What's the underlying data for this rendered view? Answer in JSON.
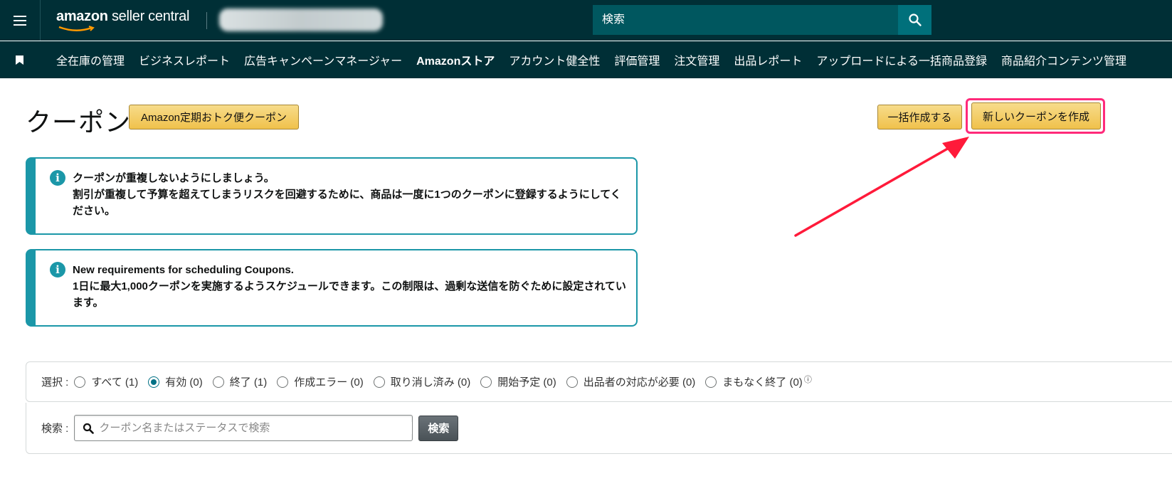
{
  "header": {
    "logo_brand": "amazon",
    "logo_product": "seller central",
    "search_placeholder": "検索",
    "menu_icon": "hamburger-menu-icon",
    "search_icon": "search-icon"
  },
  "nav": {
    "bookmark_icon": "bookmark-icon",
    "items": [
      {
        "label": "全在庫の管理"
      },
      {
        "label": "ビジネスレポート"
      },
      {
        "label": "広告キャンペーンマネージャー"
      },
      {
        "label": "Amazonストア"
      },
      {
        "label": "アカウント健全性"
      },
      {
        "label": "評価管理"
      },
      {
        "label": "注文管理"
      },
      {
        "label": "出品レポート"
      },
      {
        "label": "アップロードによる一括商品登録"
      },
      {
        "label": "商品紹介コンテンツ管理"
      }
    ]
  },
  "page": {
    "title": "クーポン",
    "subscribe_coupon_button": "Amazon定期おトク便クーポン",
    "bulk_create_button": "一括作成する",
    "new_coupon_button": "新しいクーポンを作成"
  },
  "alerts": [
    {
      "icon": "info-icon",
      "title": "クーポンが重複しないようにしましょう。",
      "body": "割引が重複して予算を超えてしまうリスクを回避するために、商品は一度に1つのクーポンに登録するようにしてください。"
    },
    {
      "icon": "info-icon",
      "title": "New requirements for scheduling Coupons.",
      "body": "1日に最大1,000クーポンを実施するようスケジュールできます。この制限は、過剰な送信を防ぐために設定されています。"
    }
  ],
  "filter": {
    "label": "選択 :",
    "options": [
      {
        "label": "すべて (1)",
        "checked": false
      },
      {
        "label": "有効 (0)",
        "checked": true
      },
      {
        "label": "終了 (1)",
        "checked": false
      },
      {
        "label": "作成エラー (0)",
        "checked": false
      },
      {
        "label": "取り消し済み (0)",
        "checked": false
      },
      {
        "label": "開始予定 (0)",
        "checked": false
      },
      {
        "label": "出品者の対応が必要 (0)",
        "checked": false
      },
      {
        "label": "まもなく終了 (0)",
        "checked": false
      }
    ],
    "info_glyph": "ⓘ"
  },
  "search": {
    "label": "検索 :",
    "placeholder": "クーポン名またはステータスで検索",
    "button": "検索"
  },
  "colors": {
    "header_bg": "#002f36",
    "accent_teal": "#1b97a8",
    "highlight": "#ff2a7a",
    "arrow": "#ff1a3a"
  }
}
